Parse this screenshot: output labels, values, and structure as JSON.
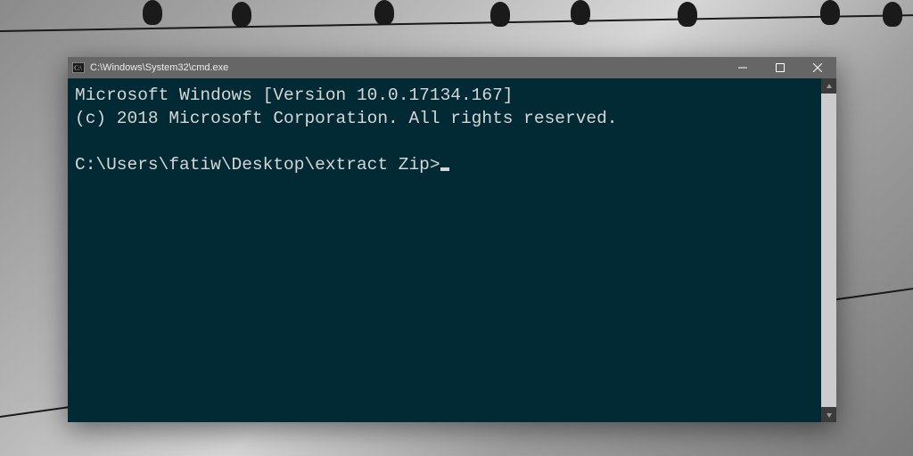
{
  "titlebar": {
    "title": "C:\\Windows\\System32\\cmd.exe"
  },
  "terminal": {
    "line1": "Microsoft Windows [Version 10.0.17134.167]",
    "line2": "(c) 2018 Microsoft Corporation. All rights reserved.",
    "blank": "",
    "prompt": "C:\\Users\\fatiw\\Desktop\\extract Zip>"
  }
}
